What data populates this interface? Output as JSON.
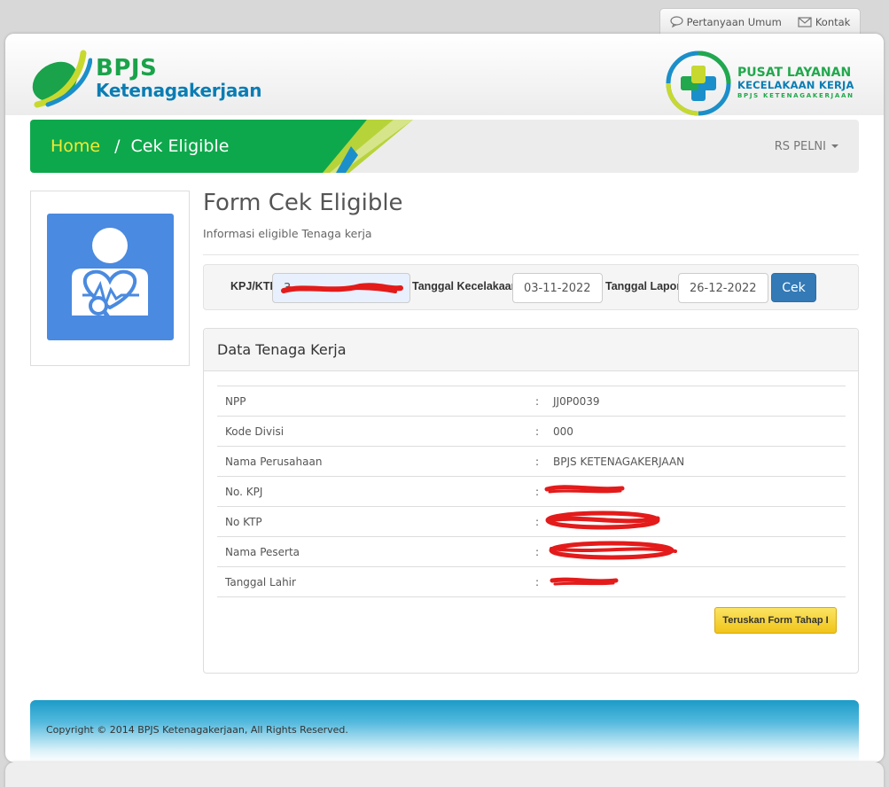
{
  "top_links": {
    "faq": "Pertanyaan Umum",
    "contact": "Kontak"
  },
  "logo": {
    "title": "BPJS",
    "subtitle": "Ketenagakerjaan"
  },
  "pusat": {
    "line1": "PUSAT LAYANAN",
    "line2": "KECELAKAAN KERJA",
    "line3": "BPJS KETENAGAKERJAAN"
  },
  "nav": {
    "home": "Home",
    "separator": "/",
    "current": "Cek Eligible",
    "user": "RS PELNI"
  },
  "form": {
    "title": "Form Cek Eligible",
    "subtitle": "Informasi eligible Tenaga kerja"
  },
  "filter": {
    "kpj_label": "KPJ/KTP",
    "kpj_value": "3",
    "accident_label": "Tanggal Kecelakaan",
    "accident_date": "03-11-2022",
    "report_label": "Tanggal Lapor",
    "report_date": "26-12-2022",
    "check_button": "Cek"
  },
  "panel": {
    "title": "Data Tenaga Kerja",
    "colon": ":",
    "rows": [
      {
        "label": "NPP",
        "value": "JJ0P0039"
      },
      {
        "label": "Kode Divisi",
        "value": "000"
      },
      {
        "label": "Nama Perusahaan",
        "value": "BPJS KETENAGAKERJAAN"
      },
      {
        "label": "No. KPJ",
        "value": ""
      },
      {
        "label": "No KTP",
        "value": ""
      },
      {
        "label": "Nama Peserta",
        "value": ""
      },
      {
        "label": "Tanggal Lahir",
        "value": ""
      }
    ],
    "next_button": "Teruskan Form Tahap I"
  },
  "footer": {
    "copyright": "Copyright © 2014 BPJS Ketenagakerjaan, All Rights Reserved."
  },
  "colors": {
    "brand_green": "#1aa34a",
    "brand_blue": "#0a7db4",
    "nav_yellow": "#f6ea2e",
    "primary_button": "#337ab7",
    "redaction": "#e31b1b"
  }
}
